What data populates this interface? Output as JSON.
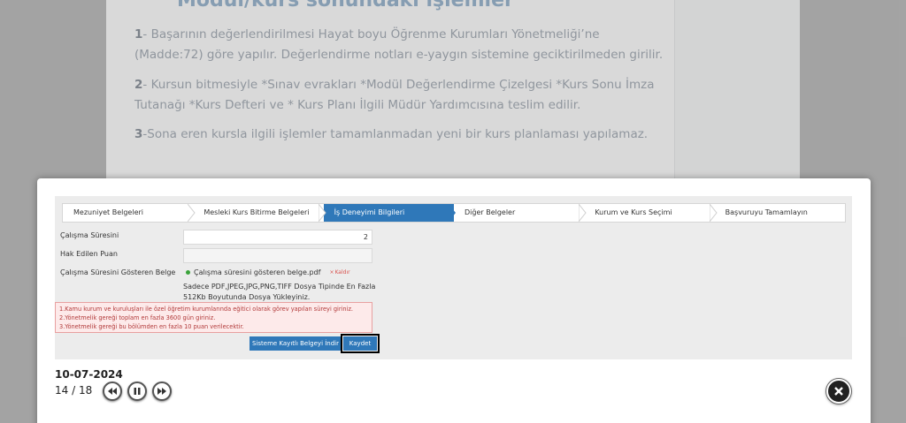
{
  "background": {
    "title": "Modül/kurs sonundaki işlemler",
    "paragraphs": [
      {
        "num": "1",
        "text": "- Başarının değerlendirilmesi Hayat boyu Öğrenme Kurumları Yönetmeliği’ne (Madde:72) göre yapılır. Değerlendirme notları e-yaygın sistemine geciktirilmeden girilir."
      },
      {
        "num": "2",
        "text": "- Kursun bitmesiyle *Sınav evrakları *Modül Değerlendirme Çizelgesi *Kurs Sonu İmza Tutanağı *Kurs Defteri ve * Kurs Planı İlgili Müdür Yardımcısına teslim edilir."
      },
      {
        "num": "3",
        "text": "-Sona eren kursla ilgili işlemler tamamlanmadan yeni bir kurs planlaması yapılamaz."
      }
    ]
  },
  "stepper": {
    "steps": [
      {
        "label": "Mezuniyet Belgeleri",
        "active": false
      },
      {
        "label": "Mesleki Kurs Bitirme Belgeleri",
        "active": false
      },
      {
        "label": "İş Deneyimi Bilgileri",
        "active": true
      },
      {
        "label": "Diğer Belgeler",
        "active": false
      },
      {
        "label": "Kurum ve Kurs Seçimi",
        "active": false
      },
      {
        "label": "Başvuruyu Tamamlayın",
        "active": false
      }
    ],
    "active_color": "#2f78b9"
  },
  "form": {
    "duration_label": "Çalışma Süresini",
    "duration_value": "2",
    "points_label": "Hak Edilen Puan",
    "points_value": "",
    "doc_label": "Çalışma Süresini Gösteren Belge",
    "file_name": "Çalışma süresini gösteren belge.pdf",
    "remove_label": "Kaldır",
    "hint_line1": "Sadece PDF,JPEG,JPG,PNG,TIFF Dosya Tipinde En Fazla",
    "hint_line2": "512Kb Boyutunda Dosya Yükleyiniz.",
    "warnings": [
      "1.Kamu kurum ve kuruluşları ile özel öğretim kurumlarında eğitici olarak görev yapılan süreyi giriniz.",
      "2.Yönetmelik gereği toplam en fazla 3600 gün giriniz.",
      "3.Yönetmelik gereği bu bölümden en fazla 10 puan verilecektir."
    ],
    "download_button": "Sisteme Kayıtlı Belgeyi İndir",
    "save_button": "Kaydet"
  },
  "lightbox": {
    "date": "10-07-2024",
    "counter": "14 / 18"
  }
}
